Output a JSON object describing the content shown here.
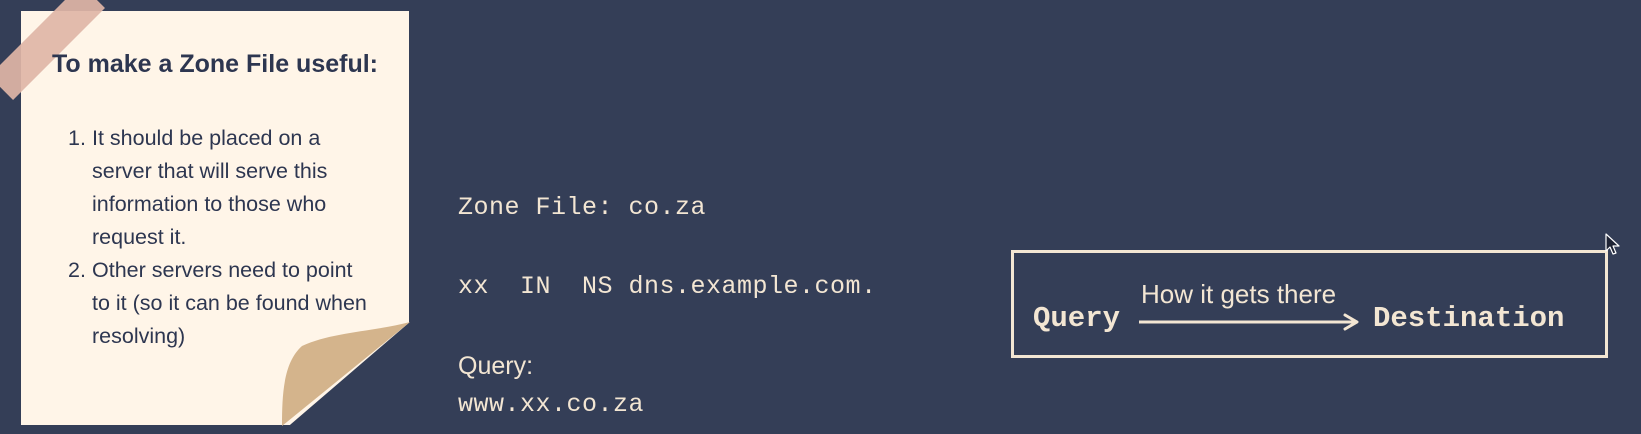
{
  "note": {
    "title": "To make a Zone File useful:",
    "items": [
      {
        "number": "1.",
        "text": "It should be placed on a server that will serve this information to those who request it."
      },
      {
        "number": "2.",
        "text": "Other servers need to point to it (so it can be found when resolving)"
      }
    ]
  },
  "zone": {
    "title": "Zone File: co.za",
    "record": "xx  IN  NS dns.example.com."
  },
  "query": {
    "label": "Query:",
    "value": "www.xx.co.za"
  },
  "flow": {
    "from": "Query",
    "caption": "How it gets there",
    "to": "Destination"
  },
  "colors": {
    "background": "#343e57",
    "note_paper": "#fff5e8",
    "note_curl": "#d4b48c",
    "tape": "#e0b5a6",
    "text_light": "#f3e6d3",
    "text_dark": "#2d3650"
  },
  "icons": {
    "cursor": "mouse-pointer-icon",
    "arrow": "arrow-right-icon"
  }
}
